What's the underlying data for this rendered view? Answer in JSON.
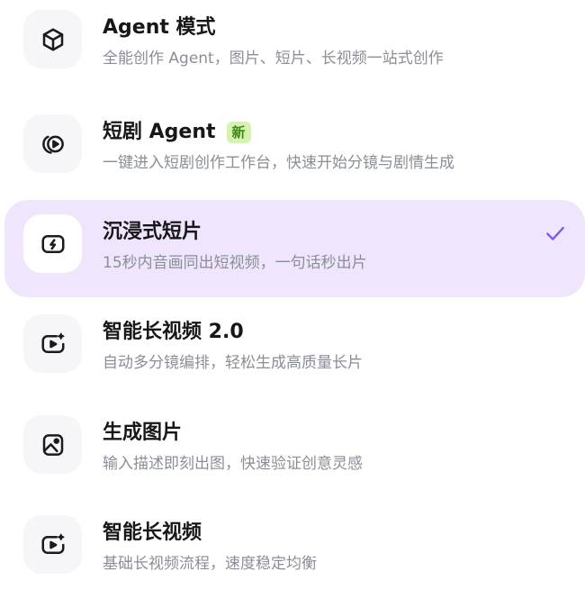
{
  "accent_color": "#7b5be8",
  "selected_bg": "#efe6fd",
  "items": [
    {
      "icon": "cube-icon",
      "title": "Agent 模式",
      "badge": "",
      "desc": "全能创作 Agent，图片、短片、长视频一站式创作",
      "selected": false
    },
    {
      "icon": "drama-play-icon",
      "title": "短剧 Agent",
      "badge": "新",
      "desc": "一键进入短剧创作工作台，快速开始分镜与剧情生成",
      "selected": false
    },
    {
      "icon": "lightning-screen-icon",
      "title": "沉浸式短片",
      "badge": "",
      "desc": "15秒内音画同出短视频，一句话秒出片",
      "selected": true
    },
    {
      "icon": "sparkle-video-icon",
      "title": "智能长视频 2.0",
      "badge": "",
      "desc": "自动多分镜编排，轻松生成高质量长片",
      "selected": false
    },
    {
      "icon": "image-icon",
      "title": "生成图片",
      "badge": "",
      "desc": "输入描述即刻出图，快速验证创意灵感",
      "selected": false
    },
    {
      "icon": "sparkle-video-icon",
      "title": "智能长视频",
      "badge": "",
      "desc": "基础长视频流程，速度稳定均衡",
      "selected": false
    }
  ]
}
